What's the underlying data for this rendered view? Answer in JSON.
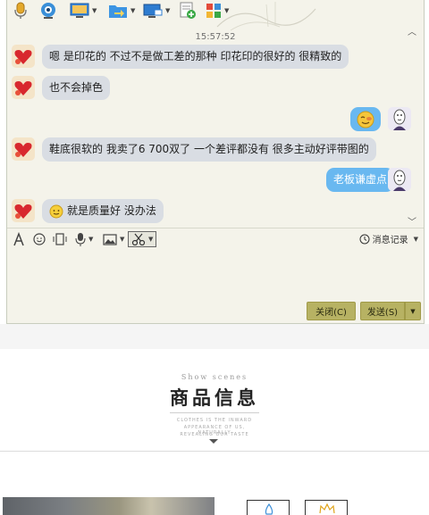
{
  "toolbar": {
    "items": [
      {
        "name": "microphone-icon",
        "has_dropdown": false
      },
      {
        "name": "webcam-icon",
        "has_dropdown": false
      },
      {
        "name": "screen-share-icon",
        "has_dropdown": true
      },
      {
        "name": "send-file-icon",
        "has_dropdown": true
      },
      {
        "name": "remote-desktop-icon",
        "has_dropdown": true
      },
      {
        "name": "add-app-icon",
        "has_dropdown": false
      },
      {
        "name": "apps-grid-icon",
        "has_dropdown": true
      }
    ]
  },
  "chat": {
    "timestamp": "15:57:52",
    "messages": [
      {
        "side": "left",
        "text": "嗯  是印花的  不过不是做工差的那种  印花印的很好的  很精致的"
      },
      {
        "side": "left",
        "text": "也不会掉色"
      },
      {
        "side": "right",
        "text": "",
        "emoji": "shy-face-icon"
      },
      {
        "side": "left",
        "text": "鞋底很软的  我卖了6 700双了  一个差评都没有  很多主动好评带图的"
      },
      {
        "side": "right",
        "text": "老板谦虚点"
      },
      {
        "side": "left",
        "text": "就是质量好  没办法",
        "emoji": "smile-face-icon"
      }
    ]
  },
  "input_toolbar": {
    "items": [
      "font-icon",
      "emoji-icon",
      "shake-icon",
      "voice-icon",
      "image-icon",
      "screenshot-icon"
    ],
    "history_label": "消息记录"
  },
  "buttons": {
    "close_label": "关闭(C)",
    "send_label": "发送(S)"
  },
  "section": {
    "subtitle_en": "Show scenes",
    "title": "商品信息",
    "small_en_lines": [
      "CLOTHES IS THE INWARD",
      "APPEARANCE OF US, NATURALLY",
      "REVEALING OUR TASTE"
    ]
  },
  "colors": {
    "left_bubble": "#d9dde3",
    "right_bubble": "#69b8f0",
    "button": "#b7b263",
    "window_bg": "#f4f3ea"
  }
}
